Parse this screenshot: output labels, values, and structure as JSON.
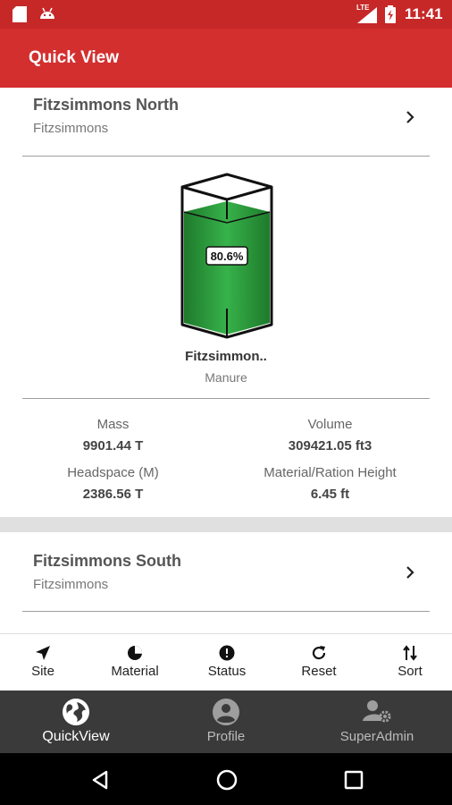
{
  "status_bar": {
    "time": "11:41",
    "network": "LTE"
  },
  "app_bar": {
    "title": "Quick View"
  },
  "cards": [
    {
      "title": "Fitzsimmons North",
      "subtitle": "Fitzsimmons",
      "tank": {
        "fill_percent": 80.6,
        "fill_label": "80.6%",
        "fill_color": "#2e9e3e",
        "name": "Fitzsimmon..",
        "material": "Manure"
      },
      "stats": {
        "mass_label": "Mass",
        "mass_value": "9901.44 T",
        "volume_label": "Volume",
        "volume_value": "309421.05 ft3",
        "headspace_label": "Headspace (M)",
        "headspace_value": "2386.56 T",
        "height_label": "Material/Ration Height",
        "height_value": "6.45 ft"
      }
    },
    {
      "title": "Fitzsimmons South",
      "subtitle": "Fitzsimmons"
    }
  ],
  "toolbar": [
    {
      "label": "Site",
      "icon": "navigation-arrow-icon"
    },
    {
      "label": "Material",
      "icon": "pie-chart-icon"
    },
    {
      "label": "Status",
      "icon": "info-icon"
    },
    {
      "label": "Reset",
      "icon": "refresh-icon"
    },
    {
      "label": "Sort",
      "icon": "sort-icon"
    }
  ],
  "bottom_nav": [
    {
      "label": "QuickView",
      "icon": "globe-icon",
      "active": true
    },
    {
      "label": "Profile",
      "icon": "profile-icon",
      "active": false
    },
    {
      "label": "SuperAdmin",
      "icon": "admin-gear-icon",
      "active": false
    }
  ],
  "colors": {
    "primary": "#d32f2f",
    "status_bar": "#c62828",
    "tank_fill": "#2e9e3e",
    "bottom_nav": "#3a3a3a"
  }
}
